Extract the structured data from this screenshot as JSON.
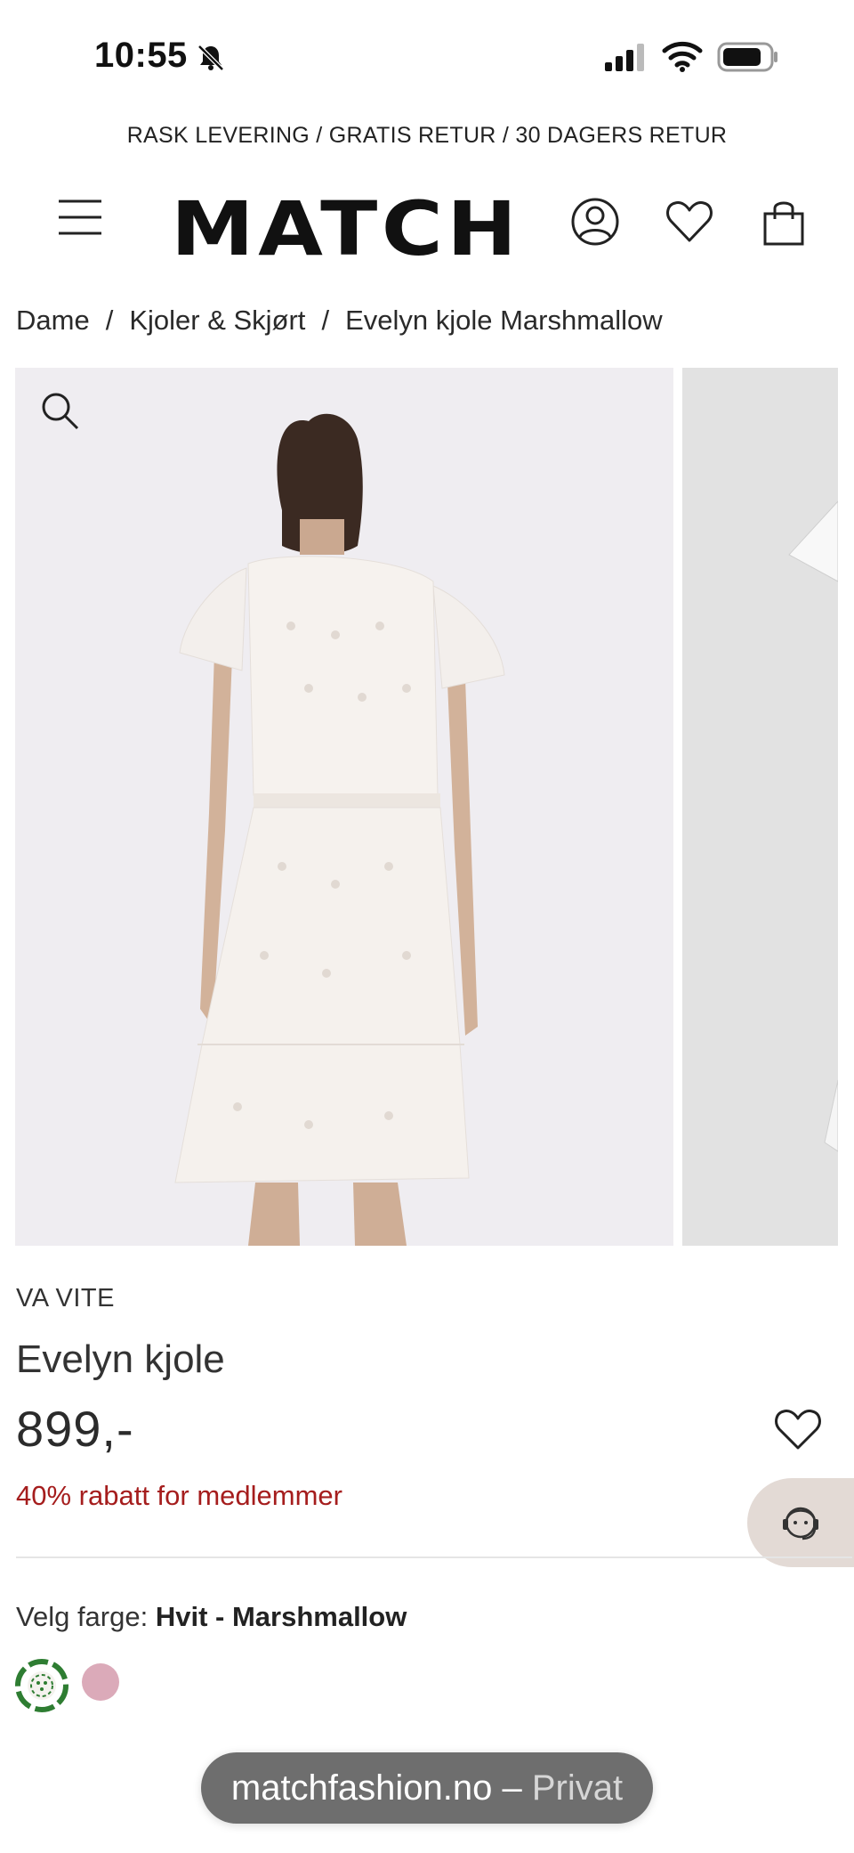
{
  "status_bar": {
    "time": "10:55"
  },
  "promo_bar": {
    "text": "RASK LEVERING / GRATIS RETUR / 30 DAGERS RETUR"
  },
  "header": {
    "logo": "MATCH",
    "icons": [
      "menu-icon",
      "account-icon",
      "heart-icon",
      "bag-icon"
    ]
  },
  "breadcrumb": {
    "items": [
      "Dame",
      "Kjoler & Skjørt",
      "Evelyn kjole Marshmallow"
    ],
    "separator": "/"
  },
  "product": {
    "brand": "VA VITE",
    "title": "Evelyn kjole",
    "price": "899,-",
    "member_offer": "40% rabatt for medlemmer",
    "color_label": "Velg farge:",
    "selected_color": "Hvit - Marshmallow",
    "swatch_colors": [
      "#2e7d32",
      "#dbaab9"
    ]
  },
  "browser": {
    "domain": "matchfashion.no",
    "dash": " – ",
    "mode": "Privat"
  },
  "colors": {
    "accent_red": "#a51d1d",
    "text": "#222222"
  }
}
